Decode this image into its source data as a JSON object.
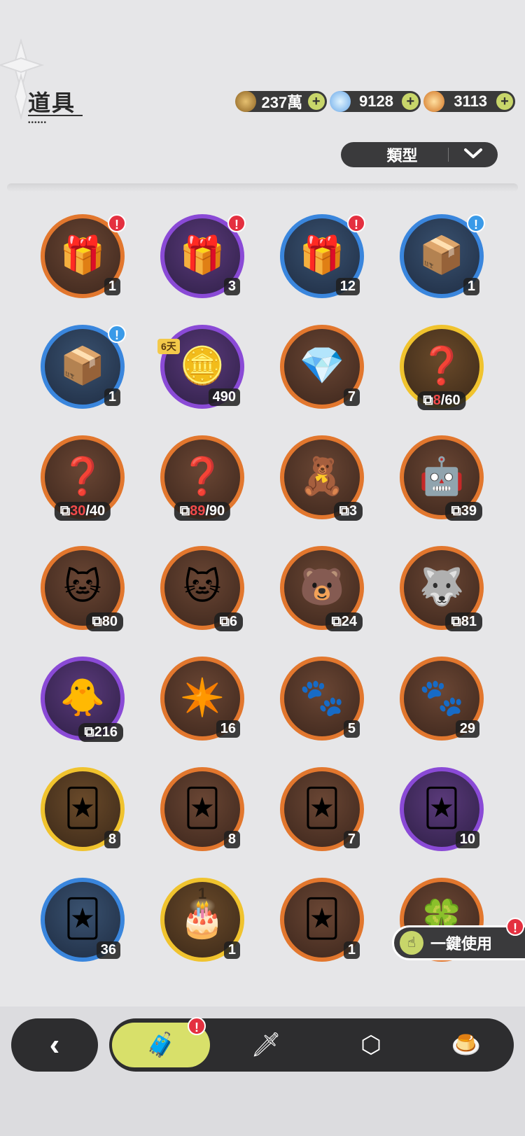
{
  "header": {
    "title": "道具"
  },
  "currencies": [
    {
      "name": "gold-coin",
      "value": "237萬",
      "color": "#c89a40"
    },
    {
      "name": "crystal",
      "value": "9128",
      "color": "#a8d4f0"
    },
    {
      "name": "star-gem",
      "value": "3113",
      "color": "#e89a30"
    }
  ],
  "filter": {
    "label": "類型"
  },
  "items": [
    {
      "icon": "orange-gift-box",
      "glyph": "🎁",
      "rarity": "orange",
      "count": "1",
      "alert": "red"
    },
    {
      "icon": "purple-gift-box",
      "glyph": "🎁",
      "rarity": "purple",
      "count": "3",
      "alert": "red"
    },
    {
      "icon": "blue-gift-box",
      "glyph": "🎁",
      "rarity": "blue",
      "count": "12",
      "alert": "red"
    },
    {
      "icon": "gem-crate",
      "glyph": "📦",
      "rarity": "blue",
      "count": "1",
      "alert": "blue"
    },
    {
      "icon": "wood-crate",
      "glyph": "📦",
      "rarity": "blue",
      "count": "1",
      "alert": "blue"
    },
    {
      "icon": "laurel-coin",
      "glyph": "🪙",
      "rarity": "purple",
      "count": "490",
      "days": "6天"
    },
    {
      "icon": "purple-crystal-card",
      "glyph": "💎",
      "rarity": "orange",
      "count": "7"
    },
    {
      "icon": "mystery-fragment-gold",
      "glyph": "❓",
      "rarity": "gold",
      "frag_have": "8",
      "frag_need": "/60"
    },
    {
      "icon": "mystery-fragment-orange",
      "glyph": "❓",
      "rarity": "orange",
      "frag_have": "30",
      "frag_need": "/40"
    },
    {
      "icon": "mystery-fragment-orange-2",
      "glyph": "❓",
      "rarity": "orange",
      "frag_have": "89",
      "frag_need": "/90"
    },
    {
      "icon": "bear-fragment",
      "glyph": "🧸",
      "rarity": "orange",
      "frag": "3"
    },
    {
      "icon": "knight-fragment",
      "glyph": "🤖",
      "rarity": "orange",
      "frag": "39"
    },
    {
      "icon": "white-cat-fragment",
      "glyph": "🐱",
      "rarity": "orange",
      "frag": "80"
    },
    {
      "icon": "leaf-cat-fragment",
      "glyph": "🐱",
      "rarity": "orange",
      "frag": "6"
    },
    {
      "icon": "red-bear-fragment",
      "glyph": "🐻",
      "rarity": "orange",
      "frag": "24"
    },
    {
      "icon": "purple-beast-fragment",
      "glyph": "🐺",
      "rarity": "orange",
      "frag": "81"
    },
    {
      "icon": "yellow-chick-fragment",
      "glyph": "🐥",
      "rarity": "purple",
      "frag": "216"
    },
    {
      "icon": "star-crystal",
      "glyph": "✴️",
      "rarity": "orange",
      "count": "16"
    },
    {
      "icon": "red-paw-charm",
      "glyph": "🐾",
      "rarity": "orange",
      "count": "5"
    },
    {
      "icon": "gold-paw-charm",
      "glyph": "🐾",
      "rarity": "orange",
      "count": "29"
    },
    {
      "icon": "gold-character-card",
      "glyph": "🃏",
      "rarity": "gold",
      "count": "8"
    },
    {
      "icon": "blue-girl-card",
      "glyph": "🃏",
      "rarity": "orange",
      "count": "8"
    },
    {
      "icon": "orange-character-card",
      "glyph": "🃏",
      "rarity": "orange",
      "count": "7"
    },
    {
      "icon": "purple-character-card",
      "glyph": "🃏",
      "rarity": "purple",
      "count": "10"
    },
    {
      "icon": "blue-character-card",
      "glyph": "🃏",
      "rarity": "blue",
      "count": "36"
    },
    {
      "icon": "birthday-cake",
      "glyph": "🎂",
      "rarity": "gold",
      "count": "1",
      "cake_num": "1"
    },
    {
      "icon": "silver-swirl-card",
      "glyph": "🃏",
      "rarity": "orange",
      "count": "1"
    },
    {
      "icon": "clover-ticket",
      "glyph": "🍀",
      "rarity": "orange",
      "count": ""
    }
  ],
  "one_click": {
    "label": "一鍵使用",
    "icon": "hand-pointer-icon"
  },
  "nav": {
    "back_icon": "chevron-left-icon",
    "tabs": [
      {
        "name": "tab-bag",
        "icon": "bag-icon",
        "glyph": "🧳",
        "active": true
      },
      {
        "name": "tab-equipment",
        "icon": "hat-sword-icon",
        "glyph": "🗡"
      },
      {
        "name": "tab-gems",
        "icon": "hexagon-gem-icon",
        "glyph": "⬡"
      },
      {
        "name": "tab-food",
        "icon": "pudding-icon",
        "glyph": "🍮"
      }
    ]
  }
}
